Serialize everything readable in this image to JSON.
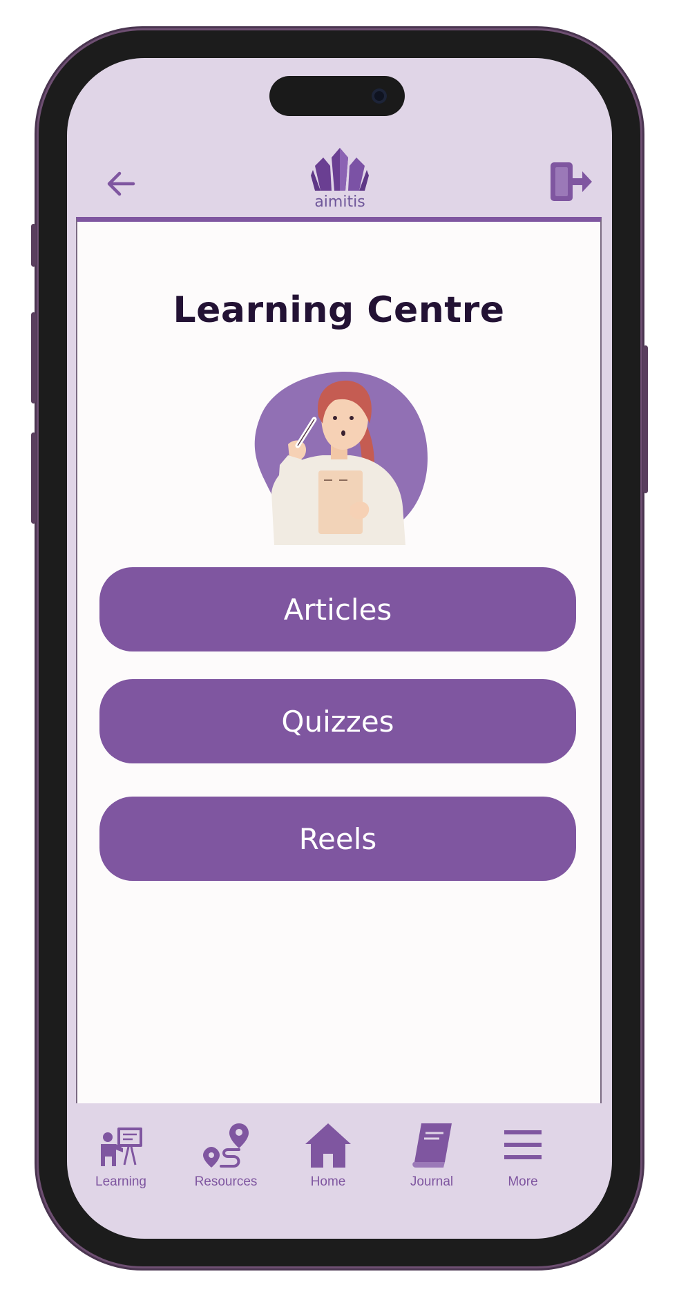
{
  "header": {
    "logo_text": "aimitis",
    "back_icon": "arrow-left-icon",
    "logout_icon": "logout-door-icon"
  },
  "main": {
    "title": "Learning Centre",
    "illustration": "woman-taking-notes-illustration",
    "buttons": [
      {
        "label": "Articles"
      },
      {
        "label": "Quizzes"
      },
      {
        "label": "Reels"
      }
    ]
  },
  "bottom_nav": {
    "items": [
      {
        "label": "Learning",
        "icon": "teacher-board-icon"
      },
      {
        "label": "Resources",
        "icon": "route-pin-icon"
      },
      {
        "label": "Home",
        "icon": "home-icon"
      },
      {
        "label": "Journal",
        "icon": "book-icon"
      },
      {
        "label": "More",
        "icon": "hamburger-menu-icon"
      }
    ]
  },
  "colors": {
    "accent": "#7f56a0",
    "screen_bg": "#e0d5e7",
    "content_bg": "#fdfbfb",
    "title_text": "#231234"
  }
}
